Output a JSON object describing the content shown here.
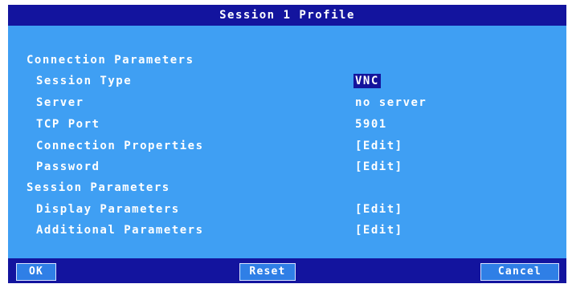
{
  "dialog": {
    "title": "Session 1 Profile",
    "sections": {
      "connection": {
        "heading": "Connection Parameters",
        "session_type": {
          "label": "Session Type",
          "value": "VNC"
        },
        "server": {
          "label": "Server",
          "value": "no server"
        },
        "tcp_port": {
          "label": "TCP Port",
          "value": "5901"
        },
        "connection_properties": {
          "label": "Connection Properties",
          "value": "[Edit]"
        },
        "password": {
          "label": "Password",
          "value": "[Edit]"
        }
      },
      "session": {
        "heading": "Session Parameters",
        "display_parameters": {
          "label": "Display Parameters",
          "value": "[Edit]"
        },
        "additional_parameters": {
          "label": "Additional Parameters",
          "value": "[Edit]"
        }
      }
    },
    "buttons": {
      "ok": "OK",
      "reset": "Reset",
      "cancel": "Cancel"
    }
  },
  "colors": {
    "title_bar": "#13149e",
    "panel": "#3f9ff3",
    "text": "#ffffff",
    "selection": "#14149c"
  }
}
